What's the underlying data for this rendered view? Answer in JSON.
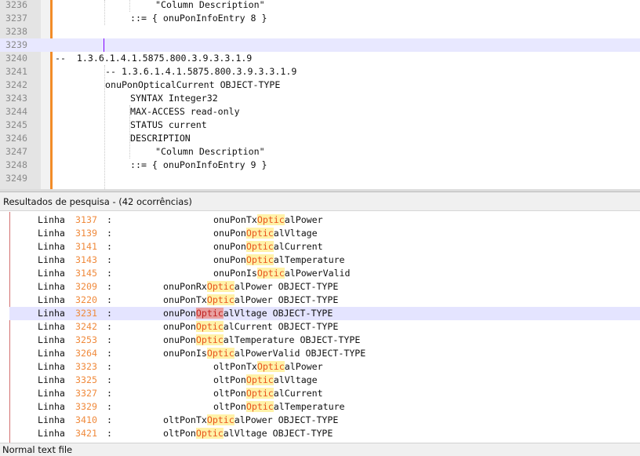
{
  "editor": {
    "lines": [
      {
        "num": "3236",
        "indent": 16,
        "text": "\"Column Description\""
      },
      {
        "num": "3237",
        "indent": 12,
        "text": "::= { onuPonInfoEntry 8 }"
      },
      {
        "num": "3238",
        "indent": 0,
        "text": ""
      },
      {
        "num": "3239",
        "indent": 0,
        "text": ""
      },
      {
        "num": "3240",
        "indent": 0,
        "text": "--  1.3.6.1.4.1.5875.800.3.9.3.3.1.9"
      },
      {
        "num": "3241",
        "indent": 8,
        "text": "-- 1.3.6.1.4.1.5875.800.3.9.3.3.1.9"
      },
      {
        "num": "3242",
        "indent": 8,
        "text": "onuPonOpticalCurrent OBJECT-TYPE"
      },
      {
        "num": "3243",
        "indent": 12,
        "text": "SYNTAX Integer32"
      },
      {
        "num": "3244",
        "indent": 12,
        "text": "MAX-ACCESS read-only"
      },
      {
        "num": "3245",
        "indent": 12,
        "text": "STATUS current"
      },
      {
        "num": "3246",
        "indent": 12,
        "text": "DESCRIPTION"
      },
      {
        "num": "3247",
        "indent": 16,
        "text": "\"Column Description\""
      },
      {
        "num": "3248",
        "indent": 12,
        "text": "::= { onuPonInfoEntry 9 }"
      },
      {
        "num": "3249",
        "indent": 0,
        "text": ""
      }
    ]
  },
  "search_results": {
    "header": "Resultados de pesquisa - (42 ocorrências)",
    "prefix_label": "Linha",
    "rows": [
      {
        "line": "3137",
        "pre": "onuPonTx",
        "match": "Optic",
        "post": "alPower",
        "indent": 16
      },
      {
        "line": "3139",
        "pre": "onuPon",
        "match": "Optic",
        "post": "alVltage",
        "indent": 16
      },
      {
        "line": "3141",
        "pre": "onuPon",
        "match": "Optic",
        "post": "alCurrent",
        "indent": 16
      },
      {
        "line": "3143",
        "pre": "onuPon",
        "match": "Optic",
        "post": "alTemperature",
        "indent": 16
      },
      {
        "line": "3145",
        "pre": "onuPonIs",
        "match": "Optic",
        "post": "alPowerValid",
        "indent": 16
      },
      {
        "line": "3209",
        "pre": "onuPonRx",
        "match": "Optic",
        "post": "alPower OBJECT-TYPE",
        "indent": 8
      },
      {
        "line": "3220",
        "pre": "onuPonTx",
        "match": "Optic",
        "post": "alPower OBJECT-TYPE",
        "indent": 8
      },
      {
        "line": "3231",
        "pre": "onuPon",
        "match": "Optic",
        "post": "alVltage OBJECT-TYPE",
        "indent": 8,
        "selected": true
      },
      {
        "line": "3242",
        "pre": "onuPon",
        "match": "Optic",
        "post": "alCurrent OBJECT-TYPE",
        "indent": 8
      },
      {
        "line": "3253",
        "pre": "onuPon",
        "match": "Optic",
        "post": "alTemperature OBJECT-TYPE",
        "indent": 8
      },
      {
        "line": "3264",
        "pre": "onuPonIs",
        "match": "Optic",
        "post": "alPowerValid OBJECT-TYPE",
        "indent": 8
      },
      {
        "line": "3323",
        "pre": "oltPonTx",
        "match": "Optic",
        "post": "alPower",
        "indent": 16
      },
      {
        "line": "3325",
        "pre": "oltPon",
        "match": "Optic",
        "post": "alVltage",
        "indent": 16
      },
      {
        "line": "3327",
        "pre": "oltPon",
        "match": "Optic",
        "post": "alCurrent",
        "indent": 16
      },
      {
        "line": "3329",
        "pre": "oltPon",
        "match": "Optic",
        "post": "alTemperature",
        "indent": 16
      },
      {
        "line": "3410",
        "pre": "oltPonTx",
        "match": "Optic",
        "post": "alPower OBJECT-TYPE",
        "indent": 8
      },
      {
        "line": "3421",
        "pre": "oltPon",
        "match": "Optic",
        "post": "alVltage OBJECT-TYPE",
        "indent": 8
      }
    ]
  },
  "statusbar": {
    "file_type": "Normal text file"
  },
  "colors": {
    "line_number": "#f08a3c",
    "match_highlight": "#fff2a8",
    "match_text": "#e8541e",
    "change_bar": "#f28c28"
  }
}
